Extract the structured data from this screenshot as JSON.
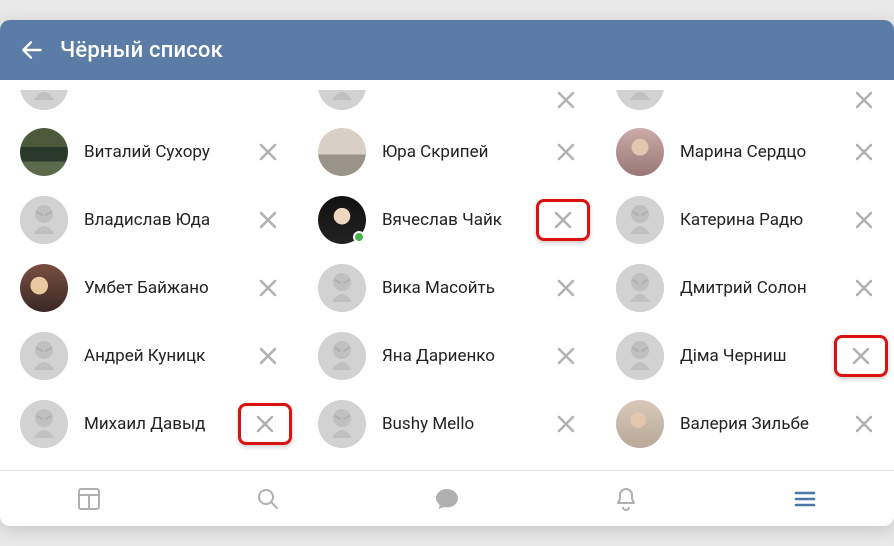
{
  "header": {
    "title": "Чёрный список"
  },
  "columns": [
    {
      "peek": {
        "ph": "",
        "rm": false
      },
      "rows": [
        {
          "name": "Виталий Сухору",
          "ph": "ph1",
          "hl": false,
          "online": false
        },
        {
          "name": "Владислав Юда",
          "ph": "",
          "hl": false,
          "online": false
        },
        {
          "name": "Умбет Байжано",
          "ph": "ph2",
          "hl": false,
          "online": false
        },
        {
          "name": "Андрей Куницк",
          "ph": "",
          "hl": false,
          "online": false
        },
        {
          "name": "Михаил Давыд",
          "ph": "",
          "hl": true,
          "online": false
        }
      ]
    },
    {
      "peek": {
        "ph": "",
        "rm": true
      },
      "rows": [
        {
          "name": "Юра Скрипей",
          "ph": "ph3",
          "hl": false,
          "online": false
        },
        {
          "name": "Вячеслав Чайк",
          "ph": "ph4",
          "hl": true,
          "online": true
        },
        {
          "name": "Вика Масойть",
          "ph": "",
          "hl": false,
          "online": false
        },
        {
          "name": "Яна Дариенко",
          "ph": "",
          "hl": false,
          "online": false
        },
        {
          "name": "Bushy Mello",
          "ph": "",
          "hl": false,
          "online": false
        }
      ]
    },
    {
      "peek": {
        "ph": "",
        "rm": true
      },
      "rows": [
        {
          "name": "Марина Сердцо",
          "ph": "ph5",
          "hl": false,
          "online": false
        },
        {
          "name": "Катерина Радю",
          "ph": "",
          "hl": false,
          "online": false
        },
        {
          "name": "Дмитрий Солон",
          "ph": "",
          "hl": false,
          "online": false
        },
        {
          "name": "Діма Черниш",
          "ph": "",
          "hl": true,
          "online": false
        },
        {
          "name": "Валерия Зильбе",
          "ph": "ph6",
          "hl": false,
          "online": false
        }
      ]
    }
  ],
  "tabs": [
    "feed",
    "search",
    "messages",
    "notifications",
    "menu"
  ],
  "active_tab": 4
}
